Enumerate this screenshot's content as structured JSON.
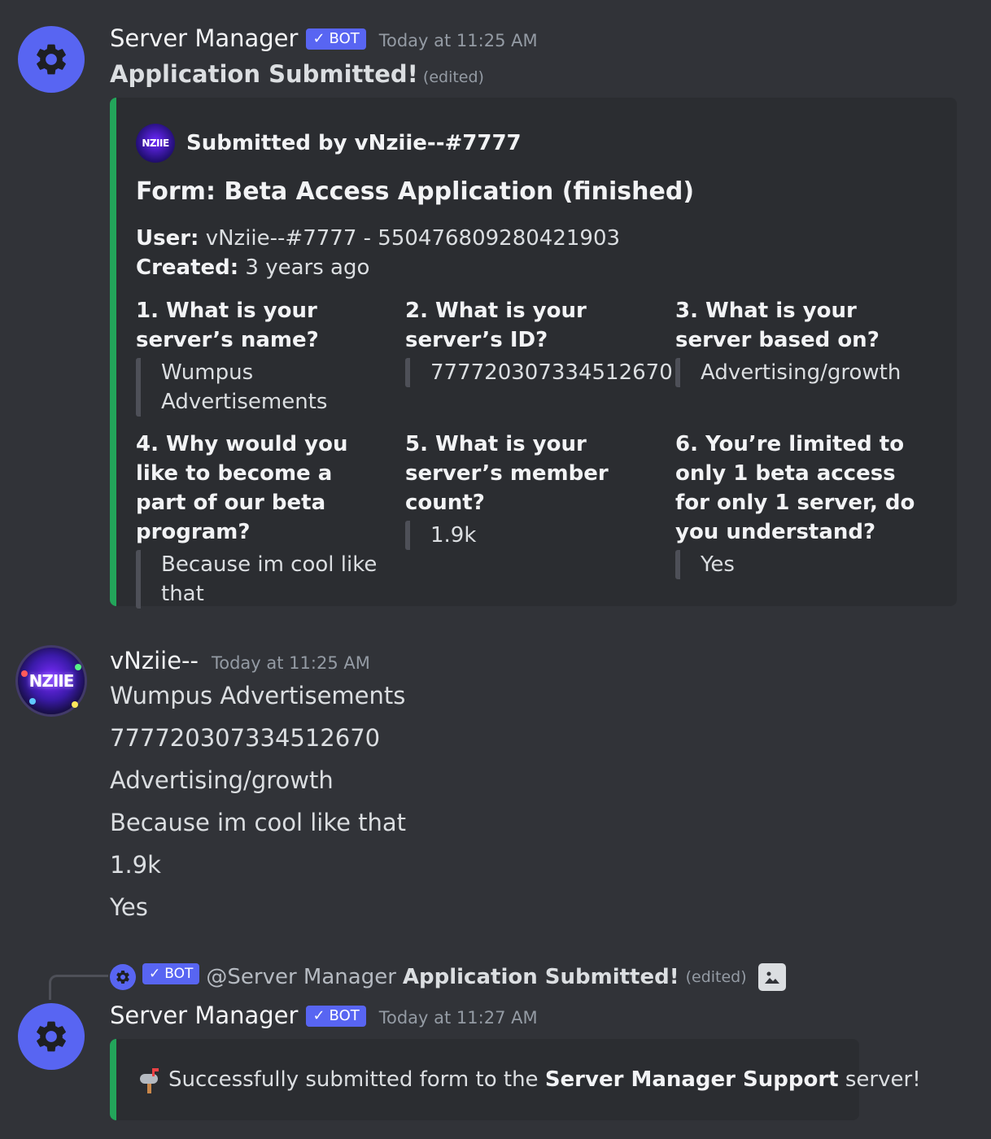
{
  "bot_tag_label": "BOT",
  "colors": {
    "accent": "#5865f2",
    "embed_bar": "#23a55a",
    "background": "#313338",
    "embed_bg": "#2b2d31"
  },
  "message1": {
    "author": "Server Manager",
    "timestamp": "Today at 11:25 AM",
    "content": "Application Submitted!",
    "edited": "(edited)",
    "embed": {
      "author_avatar_text": "NZIIE",
      "author": "Submitted by vNziie--#7777",
      "title": "Form: Beta Access Application (finished)",
      "user_label": "User:",
      "user_value": "vNziie--#7777 - 550476809280421903",
      "created_label": "Created:",
      "created_value": "3 years ago",
      "fields": [
        {
          "name": "1. What is your server’s name?",
          "value": "Wumpus Advertisements"
        },
        {
          "name": "2. What is your server’s ID?",
          "value": "777720307334512670"
        },
        {
          "name": "3. What is your server based on?",
          "value": "Advertising/growth"
        },
        {
          "name": "4. Why would you like to become a part of our beta program?",
          "value": "Because im cool like that"
        },
        {
          "name": "5. What is your server’s member count?",
          "value": "1.9k"
        },
        {
          "name": "6. You’re limited to only 1 beta access for only 1 server, do you understand?",
          "value": "Yes"
        }
      ]
    }
  },
  "message2": {
    "author": "vNziie--",
    "avatar_text": "NZIIE",
    "timestamp": "Today at 11:25 AM",
    "lines": [
      "Wumpus Advertisements",
      "777720307334512670",
      "Advertising/growth",
      "Because im cool like that",
      "1.9k",
      "Yes"
    ]
  },
  "message3": {
    "reply": {
      "mention": "@Server Manager",
      "text": "Application Submitted!",
      "edited": "(edited)",
      "attachment_icon": "image-icon"
    },
    "author": "Server Manager",
    "timestamp": "Today at 11:27 AM",
    "embed": {
      "emoji": "mailbox-icon",
      "text_before": "Successfully submitted form to the ",
      "server_name": "Server Manager Support",
      "text_after": " server!"
    }
  }
}
